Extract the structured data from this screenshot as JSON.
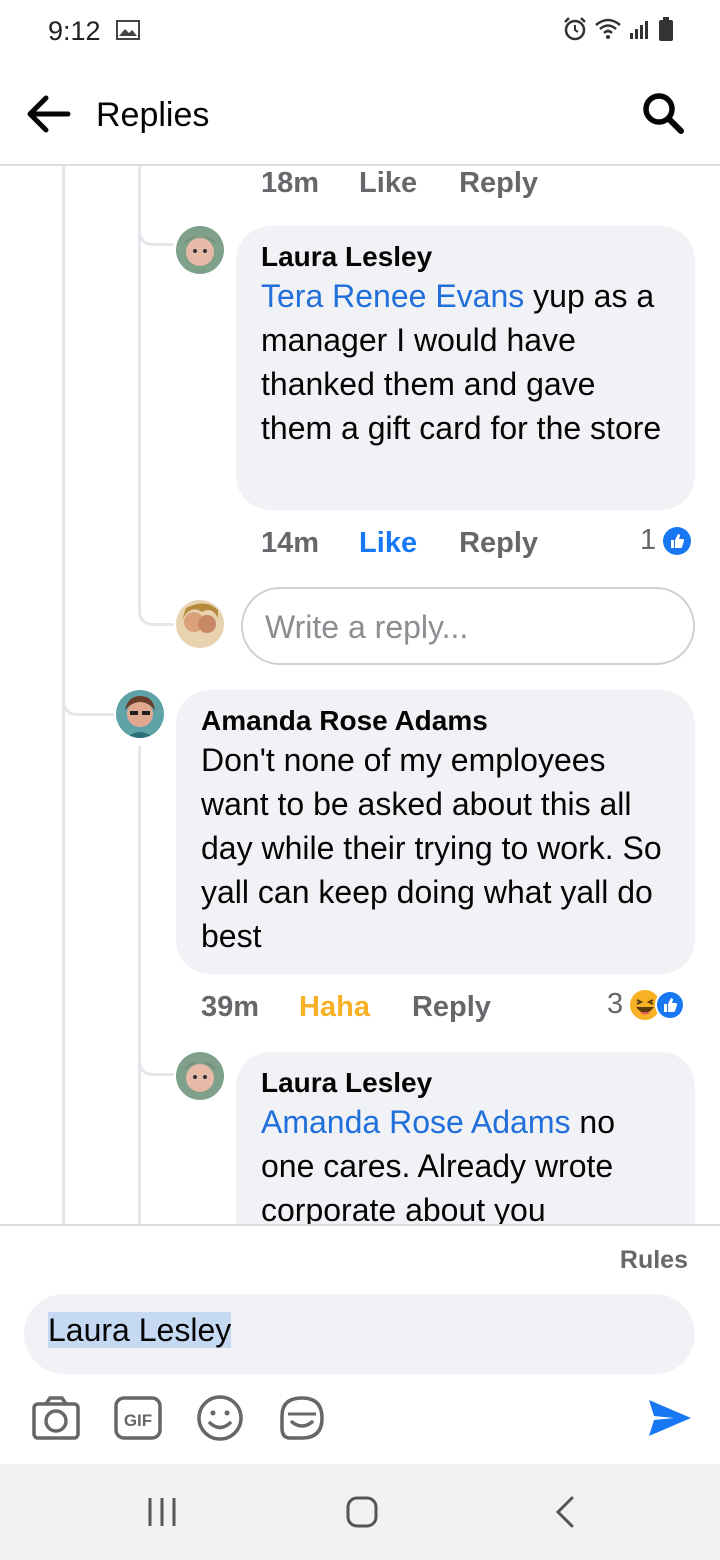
{
  "status_bar": {
    "time": "9:12"
  },
  "header": {
    "title": "Replies"
  },
  "thread": {
    "prev_comment_meta": {
      "time": "18m",
      "like": "Like",
      "reply": "Reply"
    },
    "comments": [
      {
        "author": "Laura Lesley",
        "mention": "Tera Renee Evans",
        "text": " yup as a manager I would have thanked them and gave them a gift card for the store",
        "time": "14m",
        "reaction_label": "Like",
        "reply": "Reply",
        "reaction_count": "1"
      },
      {
        "author": "Amanda Rose Adams",
        "mention": "",
        "text": "Don't none of my employees want to be asked about this all day while their trying to work.  So yall can keep doing what yall do best",
        "time": "39m",
        "reaction_label": "Haha",
        "reply": "Reply",
        "reaction_count": "3"
      },
      {
        "author": "Laura Lesley",
        "mention": "Amanda Rose Adams",
        "text": " no one cares. Already wrote corporate about you",
        "time": "",
        "reaction_label": "",
        "reply": "",
        "reaction_count": ""
      }
    ],
    "reply_placeholder": "Write a reply..."
  },
  "composer": {
    "rules_label": "Rules",
    "input_value": "Laura Lesley"
  },
  "colors": {
    "accent": "#1877f2",
    "mention": "#216fdb",
    "haha": "#f7b125",
    "bubble": "#f0f2f5",
    "meta_gray": "#65676b"
  },
  "icons": [
    "back-arrow-icon",
    "search-icon",
    "camera-icon",
    "gif-icon",
    "emoji-icon",
    "sticker-icon",
    "send-icon",
    "like-reaction-icon",
    "haha-reaction-icon"
  ]
}
